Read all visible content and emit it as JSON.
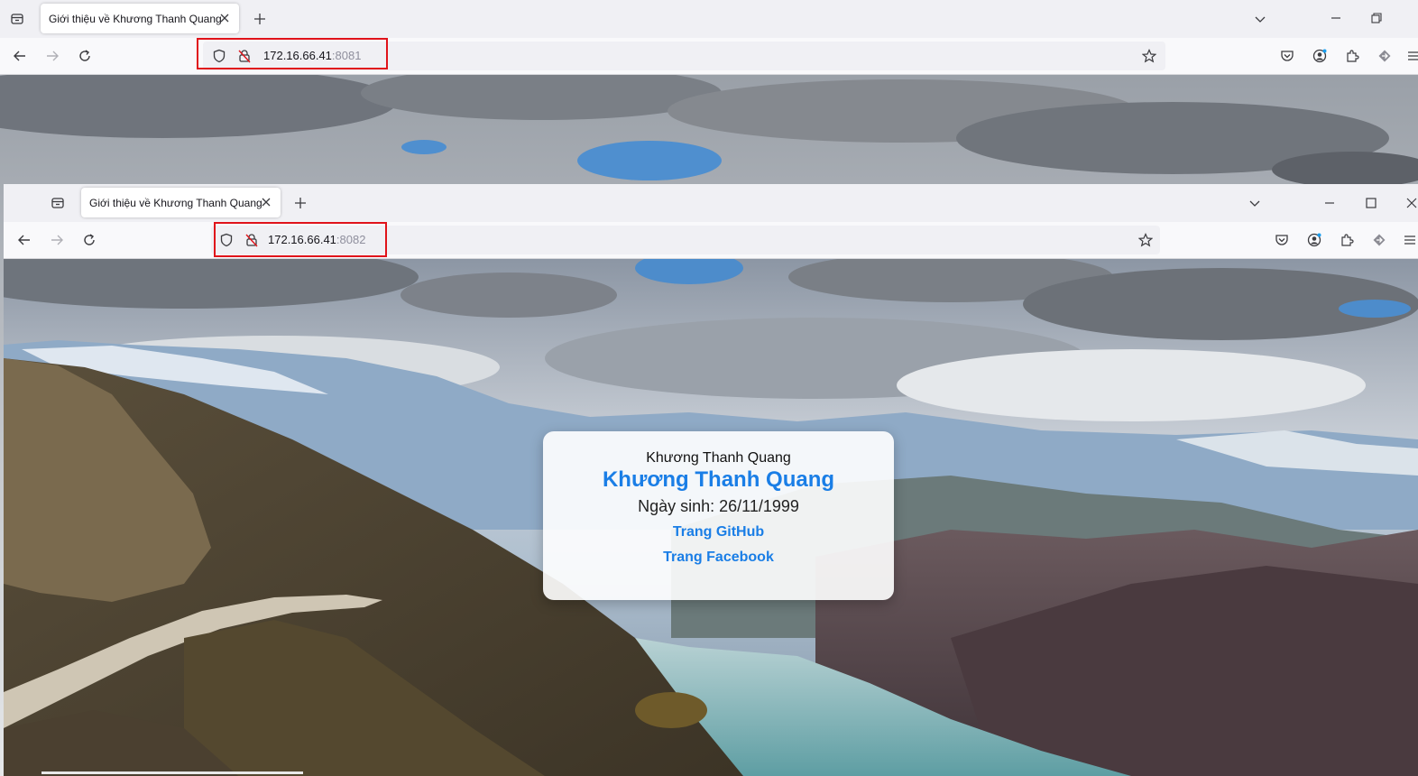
{
  "browser_back": {
    "tab_title": "Giới thiệu về Khương Thanh Quang",
    "url_host": "172.16.66.41",
    "url_port": ":8081"
  },
  "browser_front": {
    "tab_title": "Giới thiệu về Khương Thanh Quang",
    "url_host": "172.16.66.41",
    "url_port": ":8082"
  },
  "card": {
    "small_name": "Khương Thanh Quang",
    "big_name": "Khương Thanh Quang",
    "dob": "Ngày sinh: 26/11/1999",
    "github_link": "Trang GitHub",
    "facebook_link": "Trang Facebook"
  },
  "icons": [
    "tab-list-icon",
    "close-icon",
    "new-tab-icon",
    "list-all-tabs-icon",
    "minimize-icon",
    "restore-icon",
    "maximize-icon",
    "back-icon",
    "forward-icon",
    "reload-icon",
    "shield-icon",
    "insecure-lock-icon",
    "bookmark-star-icon",
    "pocket-icon",
    "account-icon",
    "extensions-icon",
    "vpn-icon",
    "menu-icon"
  ],
  "colors": {
    "link": "#1a7ee6",
    "highlight_box": "#e0131a",
    "toolbar": "#f9f9fb",
    "tabstrip": "#f0f0f4"
  }
}
